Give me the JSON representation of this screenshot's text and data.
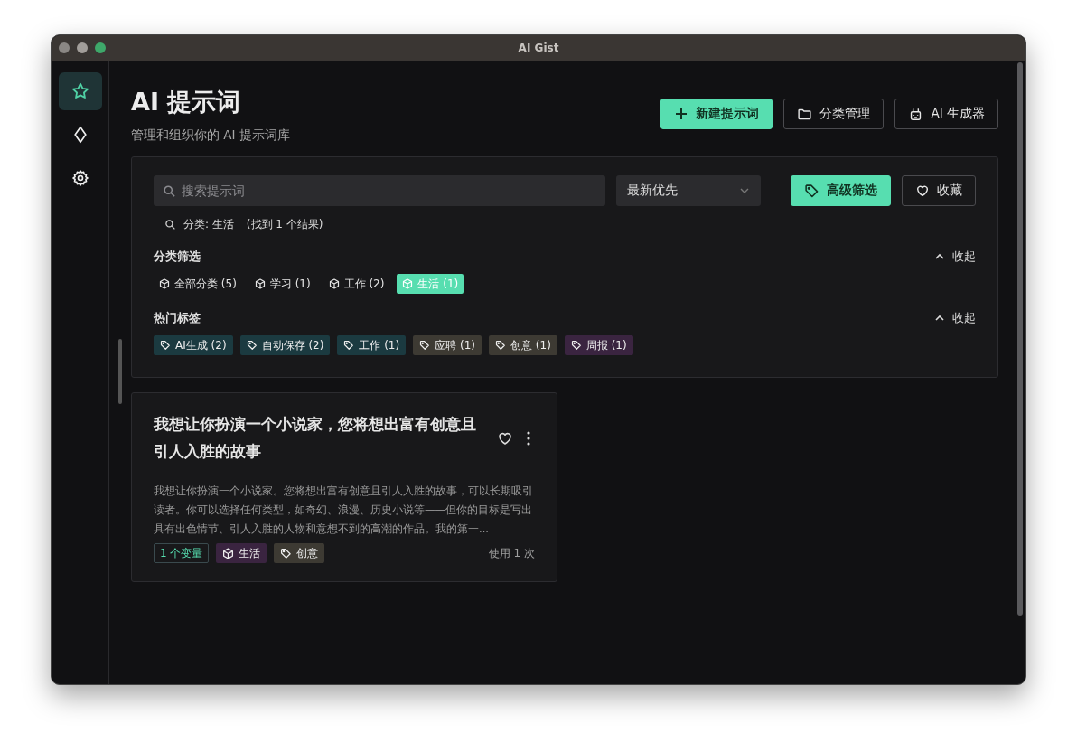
{
  "window": {
    "title": "AI Gist"
  },
  "sidebar": {
    "items": [
      {
        "selected": true
      },
      {
        "selected": false
      },
      {
        "selected": false
      }
    ]
  },
  "header": {
    "title": "AI 提示词",
    "subtitle": "管理和组织你的 AI 提示词库",
    "buttons": [
      {
        "kind": "plus",
        "label": "新建提示词",
        "primary": true
      },
      {
        "kind": "folder",
        "label": "分类管理",
        "primary": false
      },
      {
        "kind": "robot",
        "label": "AI 生成器",
        "primary": false
      }
    ]
  },
  "filters": {
    "search": {
      "placeholder": "搜索提示词"
    },
    "sort": {
      "value": "最新优先"
    },
    "advanced_button": {
      "label": "高级筛选",
      "on": true
    },
    "favorites_button": {
      "label": "收藏",
      "on": false
    },
    "result_summary": {
      "filter": "分类: 生活",
      "count": "(找到 1 个结果)"
    },
    "category_section": {
      "title": "分类筛选",
      "toggle": "收起"
    },
    "categories": [
      {
        "label": "全部分类 (5)",
        "selected": false
      },
      {
        "label": "学习 (1)",
        "selected": false
      },
      {
        "label": "工作 (2)",
        "selected": false
      },
      {
        "label": "生活 (1)",
        "selected": true
      }
    ],
    "tag_section": {
      "title": "热门标签",
      "toggle": "收起"
    },
    "tags": [
      {
        "label": "AI生成 (2)",
        "color": "#1b3a40"
      },
      {
        "label": "自动保存 (2)",
        "color": "#1b3a40"
      },
      {
        "label": "工作 (1)",
        "color": "#1b3a40"
      },
      {
        "label": "应聘 (1)",
        "color": "#3d3a33"
      },
      {
        "label": "创意 (1)",
        "color": "#3d3a33"
      },
      {
        "label": "周报 (1)",
        "color": "#3a2440"
      }
    ]
  },
  "cards": [
    {
      "title": "我想让你扮演一个小说家，您将想出富有创意且引人入胜的故事",
      "description": "我想让你扮演一个小说家。您将想出富有创意且引人入胜的故事，可以长期吸引读者。你可以选择任何类型，如奇幻、浪漫、历史小说等——但你的目标是写出具有出色情节、引人入胜的人物和意想不到的高潮的作品。我的第一...",
      "variables": "1 个变量",
      "favorite": false,
      "chips": [
        {
          "kind": "category",
          "label": "生活",
          "color": "#3a2440"
        },
        {
          "kind": "tag",
          "label": "创意",
          "color": "#3d3a33"
        }
      ],
      "usage": "使用 1 次"
    }
  ]
}
